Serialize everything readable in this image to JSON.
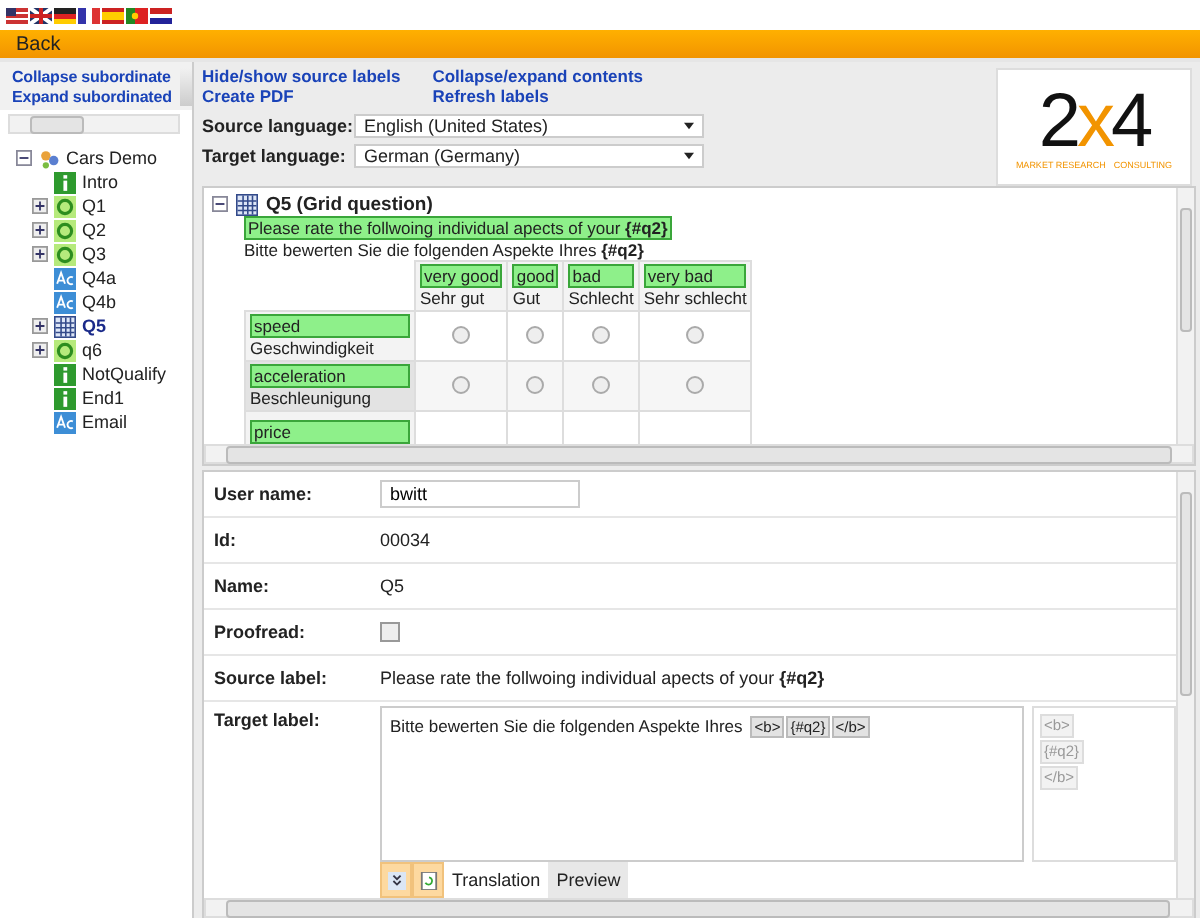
{
  "toolbar": {
    "back": "Back"
  },
  "sidebar": {
    "links": [
      "Collapse subordinate",
      "Expand subordinated"
    ],
    "tree": {
      "label": "Cars Demo",
      "expanded": true,
      "children": [
        {
          "label": "Intro",
          "kind": "info",
          "expandable": false,
          "selected": false
        },
        {
          "label": "Q1",
          "kind": "question",
          "expandable": true,
          "selected": false
        },
        {
          "label": "Q2",
          "kind": "question",
          "expandable": true,
          "selected": false
        },
        {
          "label": "Q3",
          "kind": "question",
          "expandable": true,
          "selected": false
        },
        {
          "label": "Q4a",
          "kind": "text",
          "expandable": false,
          "selected": false
        },
        {
          "label": "Q4b",
          "kind": "text",
          "expandable": false,
          "selected": false
        },
        {
          "label": "Q5",
          "kind": "grid",
          "expandable": true,
          "selected": true
        },
        {
          "label": "q6",
          "kind": "question",
          "expandable": true,
          "selected": false
        },
        {
          "label": "NotQualify",
          "kind": "info",
          "expandable": false,
          "selected": false
        },
        {
          "label": "End1",
          "kind": "info",
          "expandable": false,
          "selected": false
        },
        {
          "label": "Email",
          "kind": "text",
          "expandable": false,
          "selected": false
        }
      ]
    }
  },
  "actions": [
    [
      "Hide/show source labels",
      "Create PDF"
    ],
    [
      "Collapse/expand contents",
      "Refresh labels"
    ]
  ],
  "languages": [
    {
      "label": "Source language:",
      "value": "English (United States)"
    },
    {
      "label": "Target language:",
      "value": "German (Germany)"
    }
  ],
  "logo": {
    "mark": [
      "2",
      "x",
      "4"
    ],
    "tagline": [
      "MARKET RESEARCH",
      "CONSULTING"
    ]
  },
  "question": {
    "title": "Q5 (Grid question)",
    "expanded": true,
    "source": "Please rate the follwoing individual apects of your **{#q2}**",
    "target": "Bitte bewerten Sie die folgenden Aspekte Ihres **{#q2}**",
    "columns": [
      {
        "source": "very good",
        "target": "Sehr gut"
      },
      {
        "source": "good",
        "target": "Gut"
      },
      {
        "source": "bad",
        "target": "Schlecht"
      },
      {
        "source": "very bad",
        "target": "Sehr schlecht"
      }
    ],
    "rows": [
      {
        "source": "speed",
        "target": "Geschwindigkeit",
        "choices": [
          {
            "selected": false
          },
          {
            "selected": false
          },
          {
            "selected": false
          },
          {
            "selected": false
          }
        ]
      },
      {
        "source": "acceleration",
        "target": "Beschleunigung",
        "choices": [
          {
            "selected": false
          },
          {
            "selected": false
          },
          {
            "selected": false
          },
          {
            "selected": false
          }
        ]
      },
      {
        "source": "price"
      }
    ]
  },
  "details": [
    {
      "kind": "input",
      "label": "User name:",
      "value": "bwitt"
    },
    {
      "kind": "text",
      "label": "Id:",
      "value": "00034"
    },
    {
      "kind": "text",
      "label": "Name:",
      "value": "Q5"
    },
    {
      "kind": "checkbox",
      "label": "Proofread:",
      "checked": false
    },
    {
      "kind": "text",
      "label": "Source label:",
      "value": "Please rate the follwoing individual apects of your **{#q2}**"
    },
    {
      "kind": "editor",
      "label": "Target label:",
      "text": "Bitte bewerten Sie die folgenden Aspekte Ihres",
      "tokens": [
        "<b>",
        "{#q2}",
        "</b>"
      ],
      "palette": [
        "<b>",
        "{#q2}",
        "</b>"
      ],
      "tabs": [
        {
          "label": "Translation",
          "selected": true
        },
        {
          "label": "Preview",
          "selected": false
        }
      ]
    }
  ]
}
